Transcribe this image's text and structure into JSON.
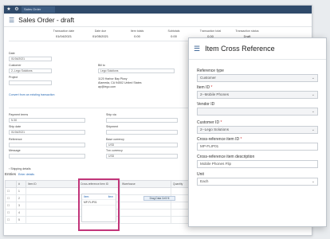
{
  "topbar": {
    "tab": "Sales Order"
  },
  "header": {
    "title": "Sales Order - draft"
  },
  "stats": [
    {
      "label": "Transaction date",
      "value": "01/04/2021"
    },
    {
      "label": "Date due",
      "value": "01/05/2021"
    },
    {
      "label": "Item totals",
      "value": "0.00"
    },
    {
      "label": "Subtotals",
      "value": "0.00"
    },
    {
      "label": "Transaction total",
      "value": "0.00"
    },
    {
      "label": "Transaction status",
      "value": "Draft"
    }
  ],
  "form": {
    "date_label": "Date",
    "date_value": "01/04/2021",
    "customer_label": "Customer",
    "customer_value": "2--Lego Solutions",
    "project_label": "Project",
    "bill_to_label": "Bill to",
    "bill_to_value": "Lego Solutions",
    "address": "1120 Harbor Bay Pkwy\nAlameda, CA 94502 United States\nap@lego.com",
    "ref_link": "Convert from an existing transaction",
    "payment_terms_label": "Payment terms",
    "payment_terms_value": "N 30",
    "ship_date_label": "Ship date",
    "ship_date_value": "01/04/2021",
    "reference_label": "Reference",
    "message_label": "Message",
    "ship_via_label": "Ship via",
    "shipment_label": "Shipment",
    "base_currency_label": "Base currency",
    "base_currency_value": "USD",
    "txn_currency_label": "Txn currency",
    "txn_currency_value": "USD",
    "shipping_details": "Shipping details"
  },
  "lines": {
    "title": "Entries",
    "link": "Enter details",
    "columns": [
      "",
      "#",
      "Item ID",
      "Cross-reference item ID",
      "Warehouse",
      "Quantity",
      "Unit"
    ],
    "rows": [
      "1",
      "2",
      "3",
      "4",
      "5"
    ],
    "dropdown_header_left": "Item",
    "dropdown_header_right": "Item",
    "dropdown_value": "MP-FLIP01",
    "tooltip": "Drag Data Cell Hi"
  },
  "dialog": {
    "title": "Item Cross Reference",
    "reference_type_label": "Reference type",
    "reference_type_value": "Customer",
    "item_id_label": "Item ID",
    "item_id_value": "2--Mobile Phones",
    "vendor_id_label": "Vendor ID",
    "vendor_id_value": "",
    "customer_id_label": "Customer ID",
    "customer_id_value": "2--Lego Solutions",
    "xref_id_label": "Cross-reference item ID",
    "xref_id_value": "MP-FLIP01",
    "xref_desc_label": "Cross-reference item description",
    "xref_desc_value": "Mobile Phones Flip",
    "unit_label": "Unit",
    "unit_value": "Each"
  }
}
